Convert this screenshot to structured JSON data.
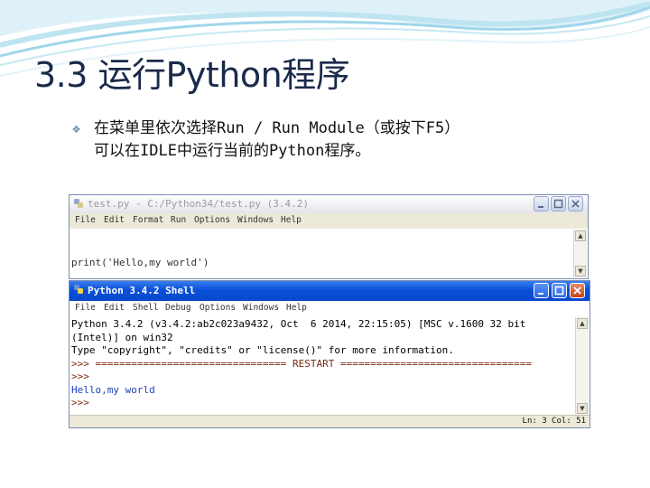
{
  "slide": {
    "title": "3.3 运行Python程序",
    "bullet_line1": "在菜单里依次选择Run / Run Module（或按下F5）",
    "bullet_line2": "可以在IDLE中运行当前的Python程序。"
  },
  "editor_window": {
    "title": "test.py - C:/Python34/test.py (3.4.2)",
    "menu": [
      "File",
      "Edit",
      "Format",
      "Run",
      "Options",
      "Windows",
      "Help"
    ],
    "code_lines": [
      "print('Hello,my world')"
    ]
  },
  "shell_window": {
    "title": "Python 3.4.2 Shell",
    "menu": [
      "File",
      "Edit",
      "Shell",
      "Debug",
      "Options",
      "Windows",
      "Help"
    ],
    "lines": [
      {
        "text": "Python 3.4.2 (v3.4.2:ab2c023a9432, Oct  6 2014, 22:15:05) [MSC v.1600 32 bit",
        "color": "#000000"
      },
      {
        "text": "(Intel)] on win32",
        "color": "#000000"
      },
      {
        "text": "Type \"copyright\", \"credits\" or \"license()\" for more information.",
        "color": "#000000"
      },
      {
        "text": ">>> ================================ RESTART ================================",
        "color": "#7a2a10"
      },
      {
        "text": ">>>",
        "color": "#7a2a10"
      },
      {
        "text": "Hello,my world",
        "color": "#1f3fbf"
      },
      {
        "text": ">>>",
        "color": "#7a2a10"
      }
    ],
    "status": "Ln: 3 Col: 51"
  },
  "colors": {
    "title_text": "#1a2a4a",
    "xp_blue": "#0a4fd8",
    "output_blue": "#1f3fbf",
    "prompt_color": "#7a2a10"
  }
}
